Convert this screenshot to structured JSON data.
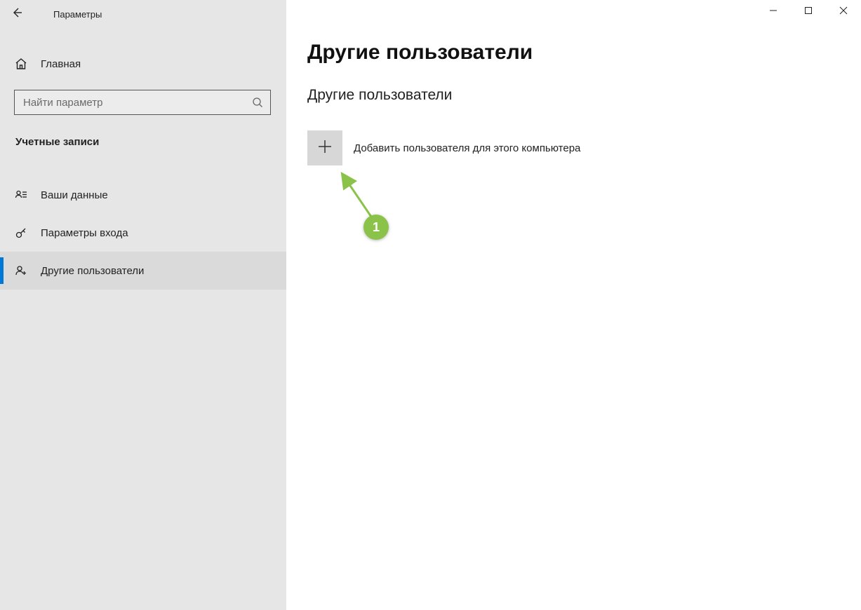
{
  "app_title": "Параметры",
  "home_label": "Главная",
  "search_placeholder": "Найти параметр",
  "category_label": "Учетные записи",
  "nav_items": [
    {
      "label": "Ваши данные",
      "icon": "person-card"
    },
    {
      "label": "Параметры входа",
      "icon": "key"
    },
    {
      "label": "Другие пользователи",
      "icon": "person-plus",
      "active": true
    }
  ],
  "page_title": "Другие пользователи",
  "section_title": "Другие пользователи",
  "add_user_label": "Добавить пользователя для этого компьютера",
  "annotation": {
    "number": "1"
  }
}
